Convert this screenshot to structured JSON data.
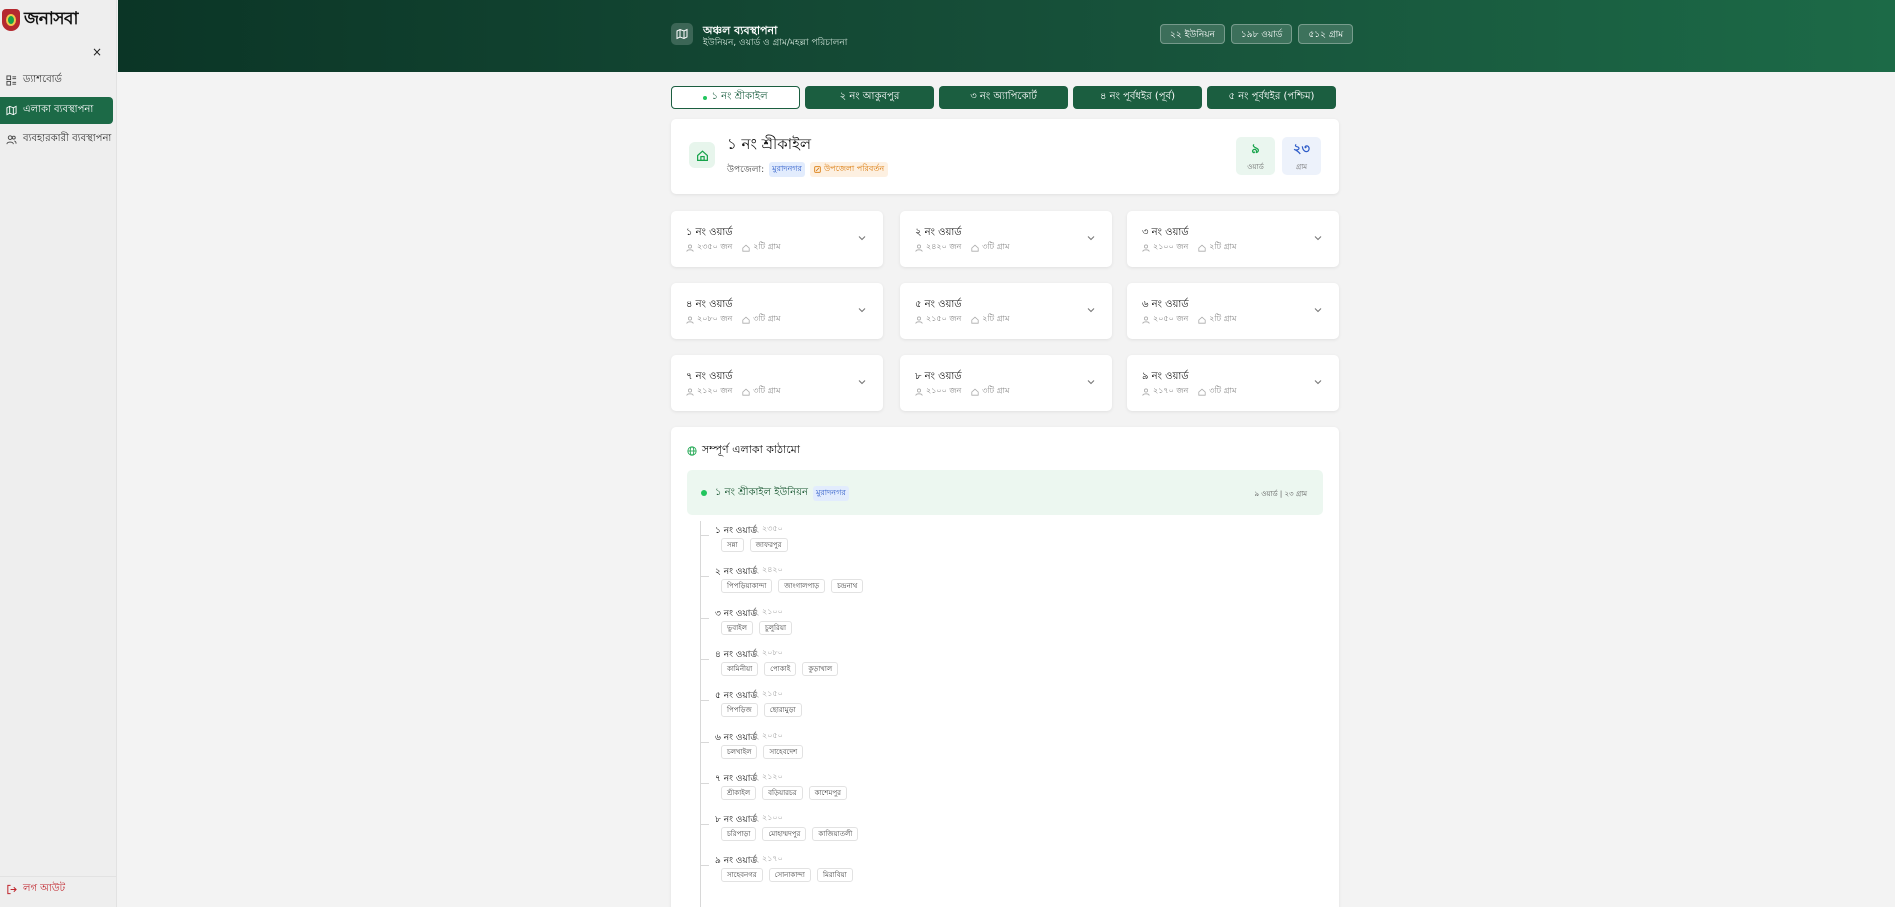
{
  "app": {
    "logo_text": "জনাসবা"
  },
  "sidebar": {
    "items": [
      {
        "label": "ড্যাশবোর্ড",
        "icon": "dashboard-icon",
        "active": false
      },
      {
        "label": "এলাকা ব্যবস্থাপনা",
        "icon": "map-icon",
        "active": true
      },
      {
        "label": "ব্যবহারকারী ব্যবস্থাপনা",
        "icon": "users-icon",
        "active": false
      }
    ],
    "close_label": "×",
    "logout_label": "লগ আউট"
  },
  "header": {
    "title": "অঞ্চল ব্যবস্থাপনা",
    "subtitle": "ইউনিয়ন, ওয়ার্ড ও গ্রাম/মহল্লা পরিচালনা",
    "pills": [
      "২২ ইউনিয়ন",
      "১৯৮ ওয়ার্ড",
      "৫১২ গ্রাম"
    ]
  },
  "tabs": [
    "১ নং শ্রীকাইল",
    "২ নং আকুবপুর",
    "৩ নং অ্যাপিকোর্ট",
    "৪ নং পূর্বধইর (পূর্ব)",
    "৫ নং পূর্বধইর (পশ্চিম)"
  ],
  "union": {
    "name": "১ নং শ্রীকাইল",
    "upazila_label": "উপজেলা:",
    "upazila": "মুরাদনগর",
    "change_upazila": "উপজেলা পরিবর্তন",
    "ward_count": "৯",
    "ward_label": "ওয়ার্ড",
    "village_count": "২৩",
    "village_label": "গ্রাম"
  },
  "wards": [
    {
      "title": "১ নং ওয়ার্ড",
      "population": "২৩৫০ জন",
      "villages": "২টি গ্রাম"
    },
    {
      "title": "২ নং ওয়ার্ড",
      "population": "২৪২০ জন",
      "villages": "৩টি গ্রাম"
    },
    {
      "title": "৩ নং ওয়ার্ড",
      "population": "২১০০ জন",
      "villages": "২টি গ্রাম"
    },
    {
      "title": "৪ নং ওয়ার্ড",
      "population": "২০৮০ জন",
      "villages": "৩টি গ্রাম"
    },
    {
      "title": "৫ নং ওয়ার্ড",
      "population": "২১৫০ জন",
      "villages": "২টি গ্রাম"
    },
    {
      "title": "৬ নং ওয়ার্ড",
      "population": "২০৫০ জন",
      "villages": "২টি গ্রাম"
    },
    {
      "title": "৭ নং ওয়ার্ড",
      "population": "২১২০ জন",
      "villages": "৩টি গ্রাম"
    },
    {
      "title": "৮ নং ওয়ার্ড",
      "population": "২১০০ জন",
      "villages": "৩টি গ্রাম"
    },
    {
      "title": "৯ নং ওয়ার্ড",
      "population": "২১৭০ জন",
      "villages": "৩টি গ্রাম"
    }
  ],
  "structure": {
    "title": "সম্পূর্ণ এলাকা কাঠামো",
    "union_name": "১ নং শ্রীকাইল ইউনিয়ন",
    "union_upazila": "মুরাদনগর",
    "union_counts": "৯ ওয়ার্ড | ২৩ গ্রাম",
    "wards": [
      {
        "name": "১ নং ওয়ার্ড",
        "population": "২৩৫০",
        "villages": [
          "সন্না",
          "জাফরপুর"
        ]
      },
      {
        "name": "২ নং ওয়ার্ড",
        "population": "২৪২০",
        "villages": [
          "পিপড়িয়াকান্দা",
          "জাংগালপাড়",
          "চন্দ্রনাথ"
        ]
      },
      {
        "name": "৩ নং ওয়ার্ড",
        "population": "২১০০",
        "villages": [
          "ভুবাইল",
          "চুলুরিয়া"
        ]
      },
      {
        "name": "৪ নং ওয়ার্ড",
        "population": "২০৮০",
        "villages": [
          "কামিনীয়া",
          "পোকাই",
          "কুড়াখাল"
        ]
      },
      {
        "name": "৫ নং ওয়ার্ড",
        "population": "২১৫০",
        "villages": [
          "পিপড়িজ",
          "ছোরামুড়া"
        ]
      },
      {
        "name": "৬ নং ওয়ার্ড",
        "population": "২০৫০",
        "villages": [
          "চলখাইল",
          "সাহেবদেশ"
        ]
      },
      {
        "name": "৭ নং ওয়ার্ড",
        "population": "২১২০",
        "villages": [
          "শ্রীকাইল",
          "বড়িয়ারচর",
          "কাশেমপুর"
        ]
      },
      {
        "name": "৮ নং ওয়ার্ড",
        "population": "২১০০",
        "villages": [
          "চরিপাড়া",
          "মোহাম্মদপুর",
          "কাজিয়াতলী"
        ]
      },
      {
        "name": "৯ নং ওয়ার্ড",
        "population": "২১৭০",
        "villages": [
          "সাহেবনগর",
          "সোনাকান্দা",
          "মিরাবিয়া"
        ]
      }
    ]
  },
  "colors": {
    "brand_dark": "#0b3526",
    "brand": "#1c6a47",
    "accent_green": "#22c55e",
    "danger": "#c0262d"
  }
}
